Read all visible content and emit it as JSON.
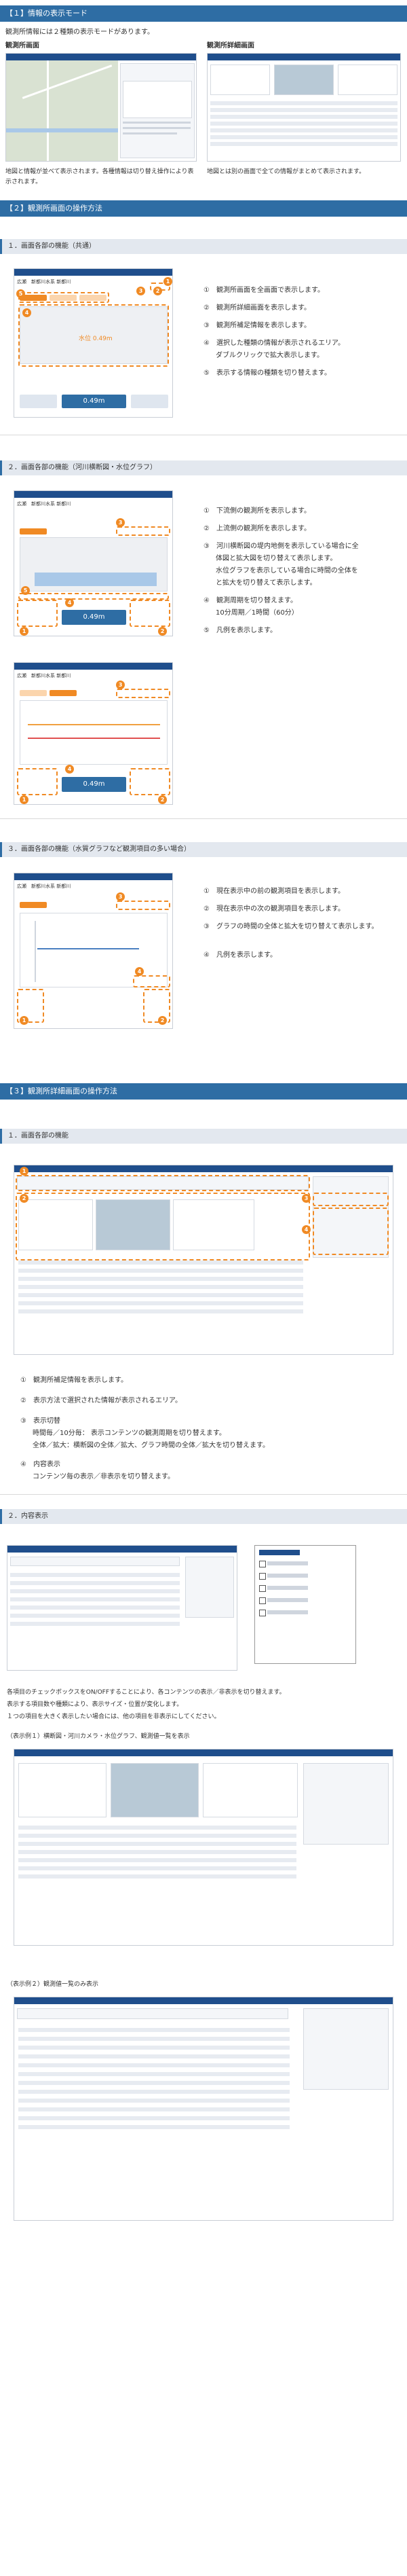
{
  "section1": {
    "title": "【１】情報の表示モード",
    "intro": "観測所情報には２種類の表示モードがあります。",
    "mode1_title": "観測所画面",
    "mode2_title": "観測所詳細画面",
    "mode1_desc": "地図と情報が並べて表示されます。各種情報は切り替え操作により表示されます。",
    "mode2_desc": "地図とは別の画面で全ての情報がまとめて表示されます。"
  },
  "section2": {
    "title": "【２】観測所画面の操作方法",
    "sub1": {
      "title": "１．画面各部の機能（共通）",
      "items": [
        {
          "mark": "①",
          "text": "観測所画面を全画面で表示します。"
        },
        {
          "mark": "②",
          "text": "観測所詳細画面を表示します。"
        },
        {
          "mark": "③",
          "text": "観測所補足情報を表示します。"
        },
        {
          "mark": "④",
          "text": "選択した種類の情報が表示されるエリア。"
        },
        {
          "mark": "",
          "text": "ダブルクリックで拡大表示します。"
        },
        {
          "mark": "⑤",
          "text": "表示する情報の種類を切り替えます。"
        }
      ]
    },
    "sub2": {
      "title": "２．画面各部の機能（河川横断図・水位グラフ）",
      "items": [
        {
          "mark": "①",
          "text": "下流側の観測所を表示します。"
        },
        {
          "mark": "②",
          "text": "上流側の観測所を表示します。"
        },
        {
          "mark": "③",
          "text": "河川横断図の堤内地側を表示している場合に全"
        },
        {
          "mark": "",
          "text": "体図と拡大図を切り替えて表示します。"
        },
        {
          "mark": "",
          "text": "水位グラフを表示している場合に時間の全体を"
        },
        {
          "mark": "",
          "text": "と拡大を切り替えて表示します。"
        },
        {
          "mark": "④",
          "text": "観測周期を切り替えます。"
        },
        {
          "mark": "",
          "text": "10分周期／1時間（60分）"
        },
        {
          "mark": "⑤",
          "text": "凡例を表示します。"
        }
      ]
    },
    "sub3": {
      "title": "３．画面各部の機能（水質グラフなど観測項目の多い場合）",
      "items": [
        {
          "mark": "①",
          "text": "現在表示中の前の観測項目を表示します。"
        },
        {
          "mark": "②",
          "text": "現在表示中の次の観測項目を表示します。"
        },
        {
          "mark": "③",
          "text": "グラフの時間の全体と拡大を切り替えて表示します。"
        },
        {
          "mark": "④",
          "text": "凡例を表示します。"
        }
      ]
    }
  },
  "section3": {
    "title": "【３】観測所詳細画面の操作方法",
    "sub1": {
      "title": "１．画面各部の機能",
      "items": [
        {
          "mark": "①",
          "text": "観測所補足情報を表示します。"
        },
        {
          "mark": "②",
          "text": "表示方法で選択された情報が表示されるエリア。"
        },
        {
          "mark": "③",
          "text": "表示切替"
        },
        {
          "mark": "",
          "text": "時間毎／10分毎： 表示コンテンツの観測周期を切り替えます。"
        },
        {
          "mark": "",
          "text": "全体／拡大：横断図の全体／拡大、グラフ時間の全体／拡大を切り替えます。"
        },
        {
          "mark": "④",
          "text": "内容表示"
        },
        {
          "mark": "",
          "text": "コンテンツ毎の表示／非表示を切り替えます。"
        }
      ]
    },
    "sub2": {
      "title": "２．内容表示",
      "desc": [
        "各項目のチェックボックスをON/OFFすることにより、各コンテンツの表示／非表示を切り替えます。",
        "表示する項目数や種類により、表示サイズ・位置が変化します。",
        "１つの項目を大きく表示したい場合には、他の項目を非表示にしてください。"
      ],
      "example1": "（表示例１）横断図・河川カメラ・水位グラフ、観測値一覧を表示",
      "example2": "（表示例２）観測値一覧のみ表示"
    }
  },
  "phone": {
    "station": "広瀬　新都川水系 新都川",
    "level": "0.49m",
    "tabs": [
      "水位グラフ",
      "河川横断図",
      "河川画像"
    ]
  }
}
